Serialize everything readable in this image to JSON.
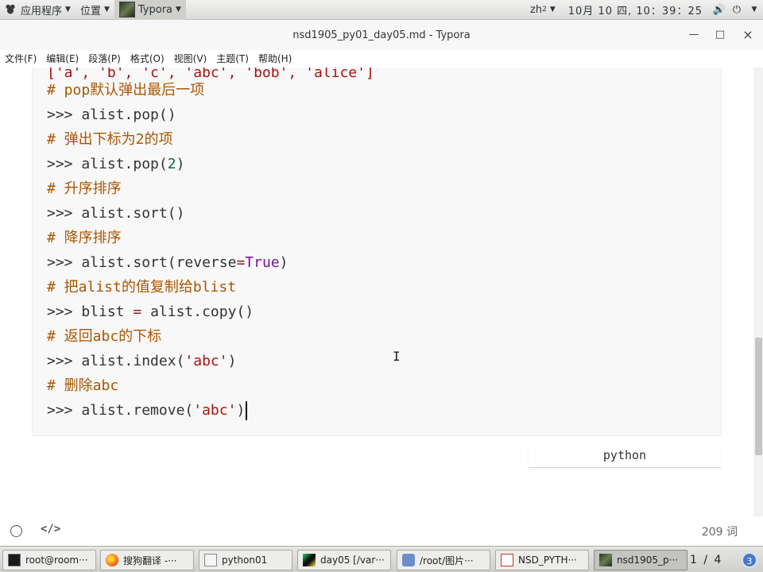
{
  "top_panel": {
    "applications": "应用程序",
    "places": "位置",
    "active_app": "Typora",
    "input_method": "zh",
    "input_method_sub": "2",
    "clock": "10月 10 四, 10：39：25"
  },
  "window": {
    "title": "nsd1905_py01_day05.md - Typora",
    "minimize_symbol": "—",
    "maximize_symbol": "□",
    "close_symbol": "×"
  },
  "menu": [
    "文件(F)",
    "编辑(E)",
    "段落(P)",
    "格式(O)",
    "视图(V)",
    "主题(T)",
    "帮助(H)"
  ],
  "code": {
    "partial_first_line": "['a', 'b', 'c', 'abc', 'bob', 'alice']",
    "prompt": ">>> ",
    "lines": [
      {
        "comment": "# pop默认弹出最后一项"
      },
      {
        "call": "alist.pop()"
      },
      {
        "comment": "# 弹出下标为2的项"
      },
      {
        "call_pre": "alist.pop(",
        "num": "2",
        "call_post": ")"
      },
      {
        "comment": "# 升序排序"
      },
      {
        "call": "alist.sort()"
      },
      {
        "comment": "# 降序排序"
      },
      {
        "call_pre": "alist.sort(reverse",
        "op": "=",
        "atom": "True",
        "call_post": ")"
      },
      {
        "comment": "# 把alist的值复制给blist"
      },
      {
        "call_pre": "blist ",
        "op": "=",
        "call_post": " alist.copy()"
      },
      {
        "comment": "# 返回abc的下标"
      },
      {
        "call_pre": "alist.index(",
        "str": "'abc'",
        "call_post": ")"
      },
      {
        "comment": "# 删除abc"
      },
      {
        "call_pre": "alist.remove(",
        "str": "'abc'",
        "call_post": ")"
      }
    ],
    "language": "python"
  },
  "status": {
    "word_count": "209 词"
  },
  "taskbar": {
    "tasks": [
      "root@room···",
      "搜狗翻译 -···",
      "python01",
      "day05 [/var···",
      "/root/图片···",
      "NSD_PYTH···",
      "nsd1905_p···"
    ],
    "pager": "1 / 4",
    "workspace_badge": "3"
  }
}
